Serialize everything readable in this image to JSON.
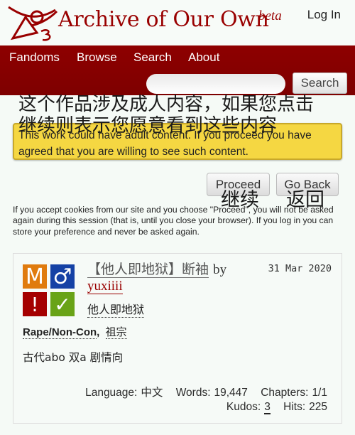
{
  "header": {
    "site_title": "Archive of Our Own",
    "beta_label": "beta",
    "login_label": "Log In"
  },
  "nav": {
    "items": [
      {
        "label": "Fandoms"
      },
      {
        "label": "Browse"
      },
      {
        "label": "Search"
      },
      {
        "label": "About"
      }
    ],
    "search_placeholder": "",
    "search_button": "Search"
  },
  "adult_warning": {
    "text": "This work could have adult content. If you proceed you have agreed that you are willing to see such content.",
    "translation_overlay": "这个作品涉及成人内容，如果您点击继续则表示您愿意看到这些内容"
  },
  "buttons": {
    "proceed_label": "Proceed",
    "proceed_translation": "继续",
    "go_back_label": "Go Back",
    "go_back_translation": "返回"
  },
  "cookie_notice": "If you accept cookies from our site and you choose \"Proceed\", you will not be asked again during this session (that is, until you close your browser). If you log in you can store your preference and never be asked again.",
  "work": {
    "title": "【他人即地狱】断袖",
    "by_label": "by",
    "author": "yuxiiii",
    "fandom": "他人即地狱",
    "date": "31 Mar 2020",
    "required_tags": {
      "rating": {
        "symbol": "M",
        "color": "#e07b0e"
      },
      "category": {
        "symbol": "♂",
        "color": "#1541a5"
      },
      "warning": {
        "symbol": "!",
        "color": "#a50000"
      },
      "complete": {
        "symbol": "✓",
        "color": "#69a317"
      }
    },
    "tags": [
      {
        "label": "Rape/Non-Con",
        "type": "warning"
      },
      {
        "label": "祖宗",
        "type": "freeform"
      }
    ],
    "tag_separator": ",",
    "summary": "古代abo 双a 剧情向",
    "stats": {
      "language_label": "Language:",
      "language": "中文",
      "words_label": "Words:",
      "words": "19,447",
      "chapters_label": "Chapters:",
      "chapters": "1/1",
      "kudos_label": "Kudos:",
      "kudos": "3",
      "hits_label": "Hits:",
      "hits": "225"
    }
  }
}
